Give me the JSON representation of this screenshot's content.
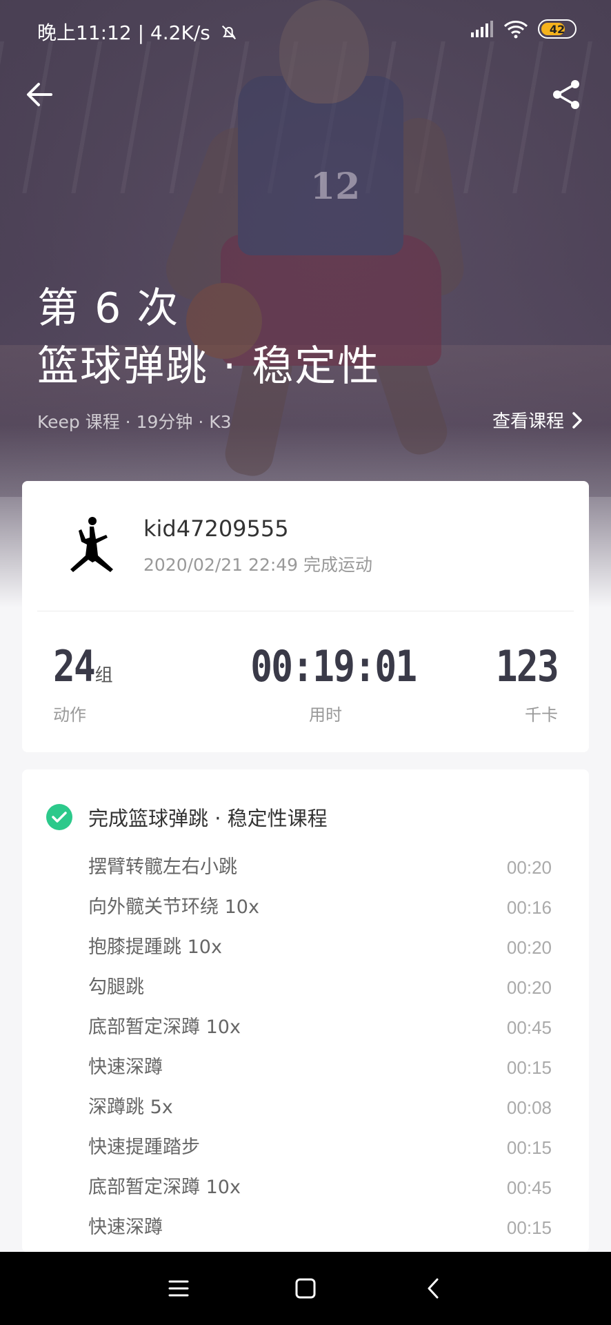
{
  "status_bar": {
    "time_speed": "晚上11:12 | 4.2K/s",
    "battery": "42"
  },
  "hero": {
    "title_line1": "第 6 次",
    "title_line2": "篮球弹跳 · 稳定性",
    "meta": "Keep 课程 · 19分钟 · K3",
    "view_course": "查看课程",
    "jersey_number": "12"
  },
  "summary": {
    "username": "kid47209555",
    "completed_at": "2020/02/21 22:49 完成运动",
    "stats": [
      {
        "value": "24",
        "unit": "组",
        "label": "动作"
      },
      {
        "value": "00:19:01",
        "unit": "",
        "label": "用时"
      },
      {
        "value": "123",
        "unit": "",
        "label": "千卡"
      }
    ]
  },
  "detail": {
    "complete_title": "完成篮球弹跳 · 稳定性课程",
    "exercises": [
      {
        "name": "摆臂转髋左右小跳",
        "time": "00:20"
      },
      {
        "name": "向外髋关节环绕 10x",
        "time": "00:16"
      },
      {
        "name": "抱膝提踵跳 10x",
        "time": "00:20"
      },
      {
        "name": "勾腿跳",
        "time": "00:20"
      },
      {
        "name": "底部暂定深蹲 10x",
        "time": "00:45"
      },
      {
        "name": "快速深蹲",
        "time": "00:15"
      },
      {
        "name": "深蹲跳 5x",
        "time": "00:08"
      },
      {
        "name": "快速提踵踏步",
        "time": "00:15"
      },
      {
        "name": "底部暂定深蹲 10x",
        "time": "00:45"
      },
      {
        "name": "快速深蹲",
        "time": "00:15"
      }
    ]
  },
  "colors": {
    "accent_green": "#2cc98b",
    "hero_overlay": "#4a4054",
    "battery_fill": "#f5b21d"
  },
  "icons": [
    "back-arrow-icon",
    "share-icon",
    "chevron-right-icon",
    "check-circle-icon",
    "jumpman-logo-icon",
    "signal-icon",
    "wifi-icon",
    "mute-bell-icon",
    "nav-menu-icon",
    "nav-home-icon",
    "nav-back-icon"
  ]
}
